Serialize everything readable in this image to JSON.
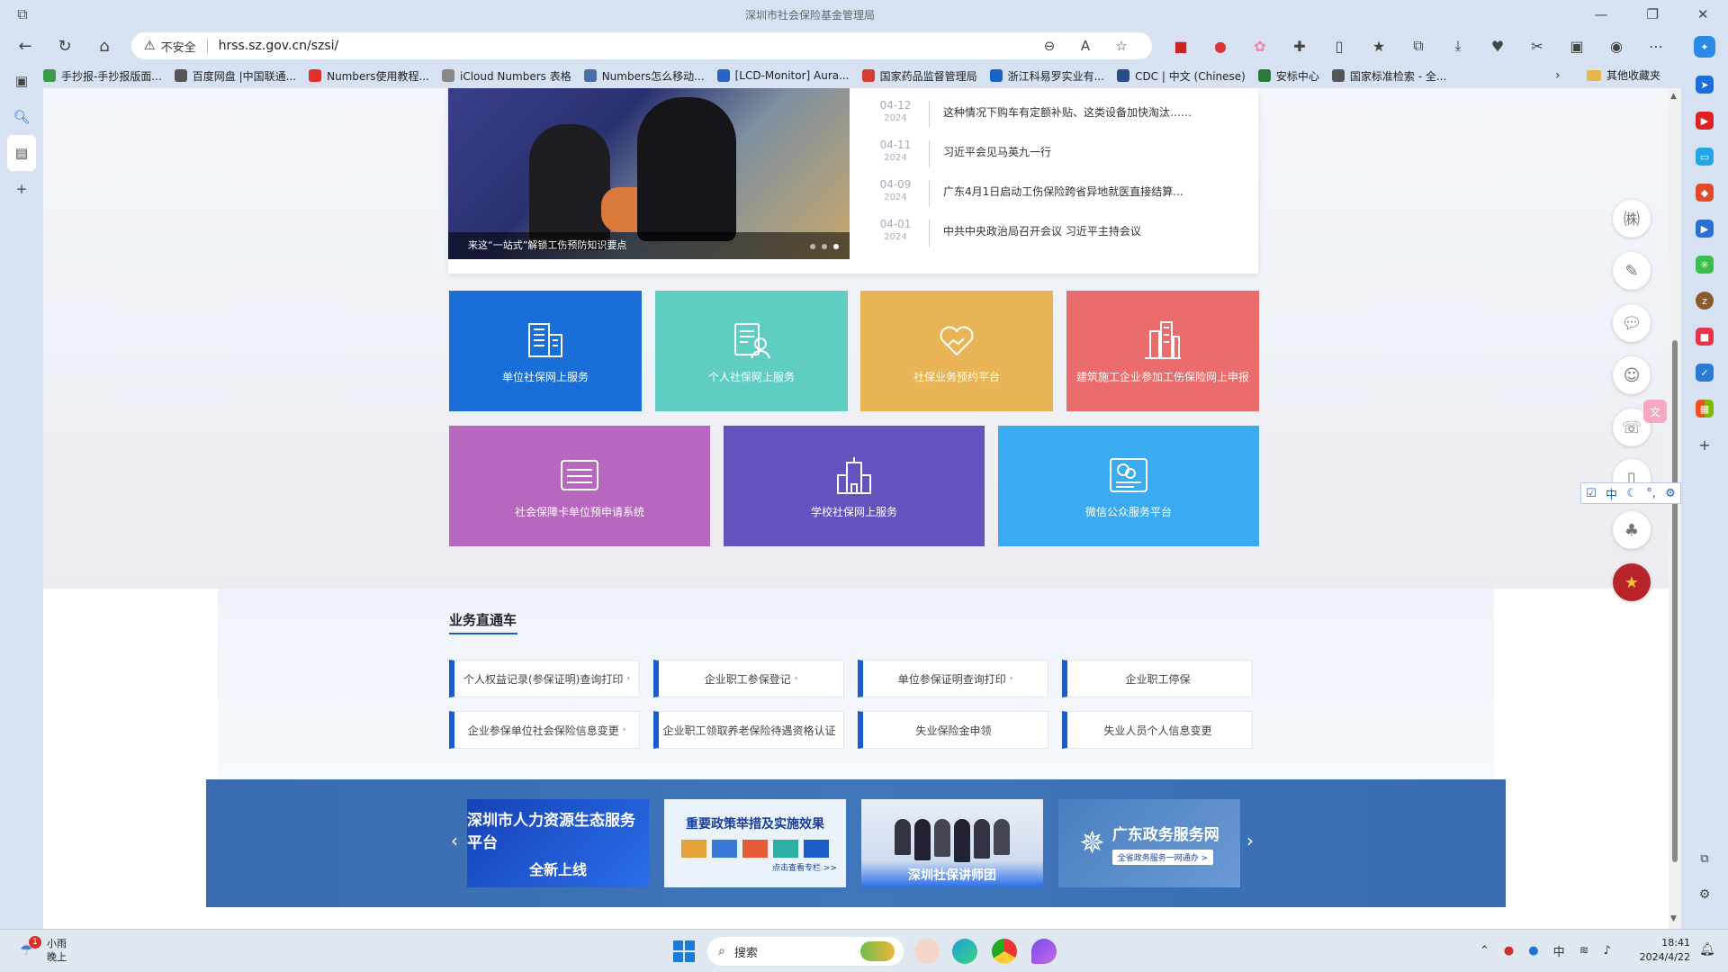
{
  "browser": {
    "tab_title": "深圳市社会保险基金管理局",
    "security_label": "不安全",
    "url": "hrss.sz.gov.cn/szsi/",
    "bookmarks": [
      {
        "label": "手抄报-手抄报版面...",
        "color": "#3b9a45"
      },
      {
        "label": "百度网盘 |中国联通...",
        "color": "#555555"
      },
      {
        "label": "Numbers使用教程...",
        "color": "#e0302b"
      },
      {
        "label": "iCloud Numbers 表格",
        "color": "#888888"
      },
      {
        "label": "Numbers怎么移动...",
        "color": "#4a6fa8"
      },
      {
        "label": "[LCD-Monitor] Aura...",
        "color": "#2a63c6"
      },
      {
        "label": "国家药品监督管理局",
        "color": "#d63d2e"
      },
      {
        "label": "浙江科易罗实业有...",
        "color": "#1a63c6"
      },
      {
        "label": "CDC | 中文 (Chinese)",
        "color": "#2b4a8a"
      },
      {
        "label": "安标中心",
        "color": "#2a7a3a"
      },
      {
        "label": "国家标准检索 - 全...",
        "color": "#555555"
      }
    ],
    "other_bookmarks": "其他收藏夹"
  },
  "news": {
    "caption": "来这“一站式”解锁工伤预防知识要点",
    "items": [
      {
        "md": "04-12",
        "year": "2024",
        "title": "这种情况下购车有定额补贴、这类设备加快淘汰……"
      },
      {
        "md": "04-11",
        "year": "2024",
        "title": "习近平会见马英九一行"
      },
      {
        "md": "04-09",
        "year": "2024",
        "title": "广东4月1日启动工伤保险跨省异地就医直接结算..."
      },
      {
        "md": "04-01",
        "year": "2024",
        "title": "中共中央政治局召开会议 习近平主持会议"
      }
    ]
  },
  "tiles": [
    {
      "label": "单位社保网上服务",
      "color": "#1a6ed8"
    },
    {
      "label": "个人社保网上服务",
      "color": "#5fcdc2"
    },
    {
      "label": "社保业务预约平台",
      "color": "#e8b455"
    },
    {
      "label": "建筑施工企业参加工伤保险网上申报",
      "color": "#ea6c6c"
    },
    {
      "label": "社会保障卡单位预申请系统",
      "color": "#b767bd"
    },
    {
      "label": "学校社保网上服务",
      "color": "#6652bf"
    },
    {
      "label": "微信公众服务平台",
      "color": "#3aabf0"
    }
  ],
  "express": {
    "title": "业务直通车",
    "buttons": [
      {
        "label": "个人权益记录(参保证明)查询打印",
        "arrow": "›"
      },
      {
        "label": "企业职工参保登记",
        "arrow": "›"
      },
      {
        "label": "单位参保证明查询打印",
        "arrow": "›"
      },
      {
        "label": "企业职工停保",
        "arrow": ""
      },
      {
        "label": "企业参保单位社会保险信息变更",
        "arrow": "›"
      },
      {
        "label": "企业职工领取养老保险待遇资格认证",
        "arrow": ""
      },
      {
        "label": "失业保险金申领",
        "arrow": ""
      },
      {
        "label": "失业人员个人信息变更",
        "arrow": ""
      }
    ]
  },
  "banners": {
    "b1": {
      "line1": "深圳市人力资源生态服务平台",
      "line2": "全新上线"
    },
    "b2": {
      "line1": "重要政策举措及实施效果",
      "line2": "点击查看专栏 >>"
    },
    "b3": {
      "line1": "深圳社保讲师团"
    },
    "b4": {
      "line1": "广东政务服务网",
      "line2": "全省政务服务一网通办 >"
    }
  },
  "taskbar": {
    "weather_badge": "1",
    "weather_line1": "小雨",
    "weather_line2": "晚上",
    "search_label": "搜索",
    "time": "18:41",
    "date": "2024/4/22",
    "ime": "中"
  },
  "float_toolbar": {
    "lang": "中"
  }
}
